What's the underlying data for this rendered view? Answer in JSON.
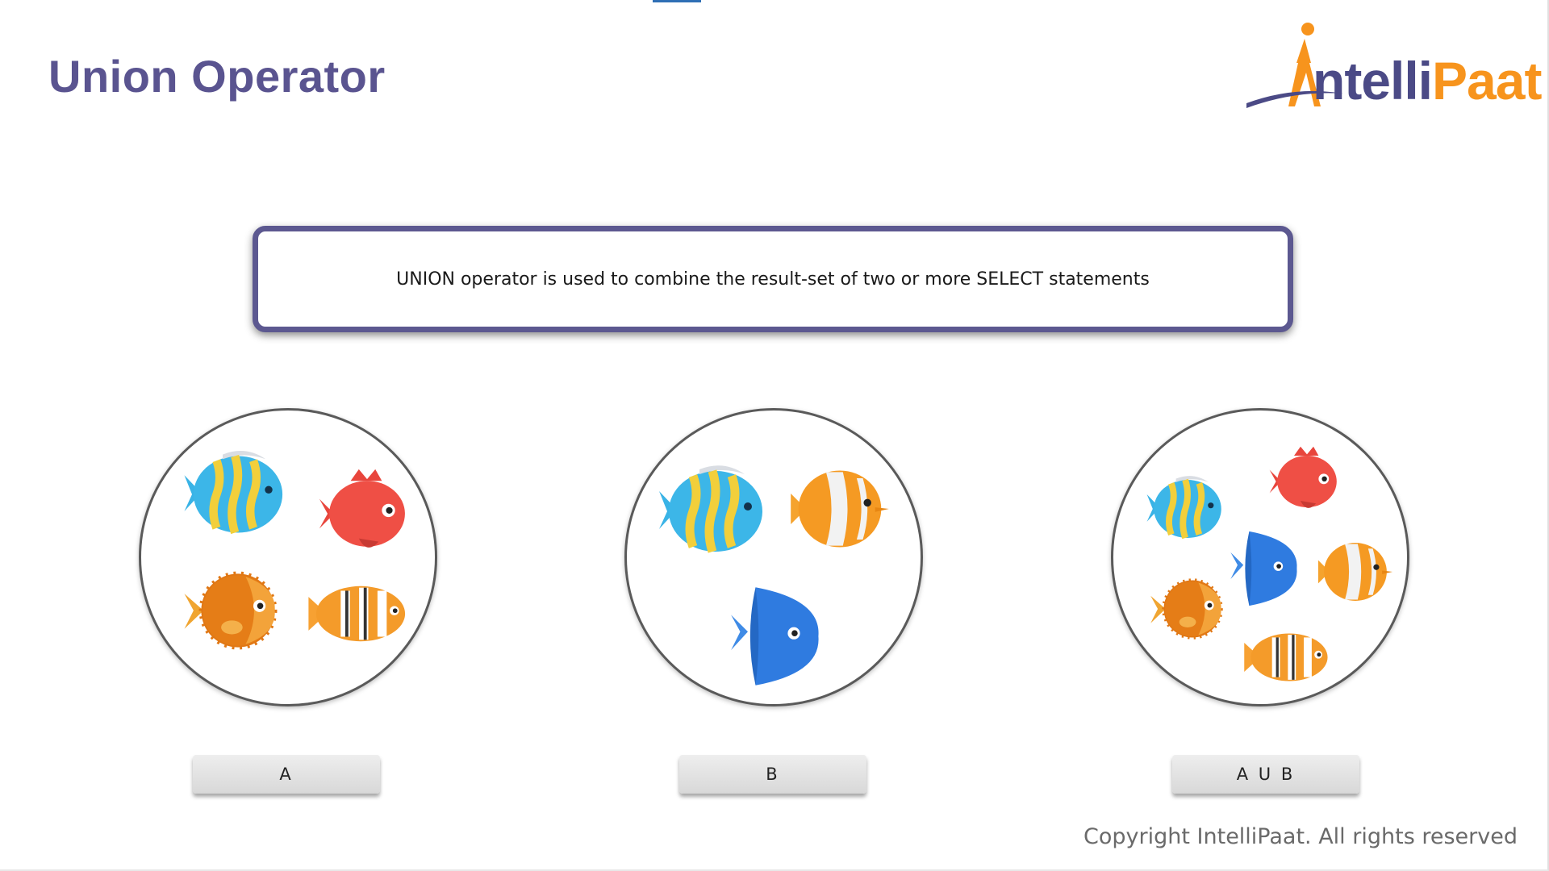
{
  "slide": {
    "title": "Union Operator",
    "logo": {
      "text_main": "ntelli",
      "text_accent": "Paat",
      "full_text": "IntelliPaat"
    },
    "definition": "UNION operator is used to combine the result-set of two or more SELECT statements",
    "sets": [
      {
        "label": "A",
        "fish": [
          "blue-striped-fish-icon",
          "red-fish-icon",
          "pufferfish-icon",
          "clownfish-icon"
        ]
      },
      {
        "label": "B",
        "fish": [
          "blue-striped-fish-icon",
          "orange-fish-icon",
          "blue-fish-icon"
        ]
      },
      {
        "label": "A U B",
        "fish": [
          "blue-striped-fish-icon",
          "red-fish-icon",
          "blue-fish-icon",
          "orange-fish-icon",
          "pufferfish-icon",
          "clownfish-icon"
        ]
      }
    ],
    "copyright": "Copyright IntelliPaat. All rights reserved"
  },
  "colors": {
    "title": "#5a5490",
    "box_border": "#5c5890",
    "logo_purple": "#4b4a86",
    "logo_orange": "#f7941d"
  }
}
